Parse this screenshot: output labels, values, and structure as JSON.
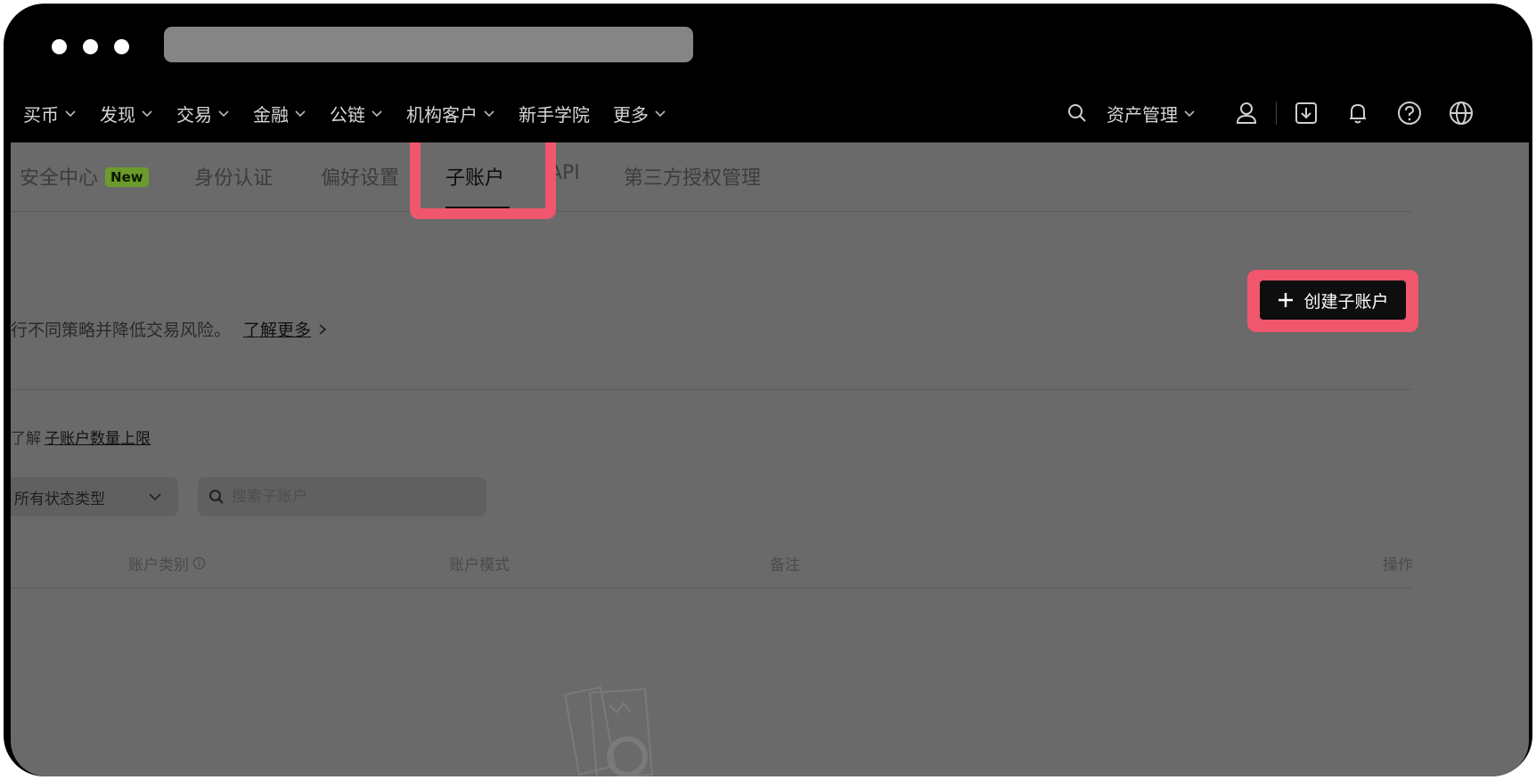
{
  "nav": {
    "items": [
      {
        "label": "买币",
        "has_menu": true
      },
      {
        "label": "发现",
        "has_menu": true
      },
      {
        "label": "交易",
        "has_menu": true
      },
      {
        "label": "金融",
        "has_menu": true
      },
      {
        "label": "公链",
        "has_menu": true
      },
      {
        "label": "机构客户",
        "has_menu": true
      },
      {
        "label": "新手学院",
        "has_menu": false
      },
      {
        "label": "更多",
        "has_menu": true
      }
    ],
    "asset_mgmt": "资产管理"
  },
  "tabs": {
    "security": "安全中心",
    "security_badge": "New",
    "identity": "身份认证",
    "preferences": "偏好设置",
    "subaccount": "子账户",
    "api": "API",
    "third_party": "第三方授权管理"
  },
  "intro": {
    "text": "行不同策略并降低交易风险。",
    "learn_more": "了解更多"
  },
  "create_button": "创建子账户",
  "limit": {
    "prefix": "了解",
    "link": "子账户数量上限"
  },
  "filter": {
    "status_select": "所有状态类型",
    "search_placeholder": "搜索子账户"
  },
  "table": {
    "headers": {
      "account_type": "账户类别",
      "account_mode": "账户模式",
      "note": "备注",
      "actions": "操作"
    }
  },
  "colors": {
    "highlight": "#f0576d",
    "badge": "#6b9b2c",
    "overlay_gray": "#6a6a6a"
  }
}
